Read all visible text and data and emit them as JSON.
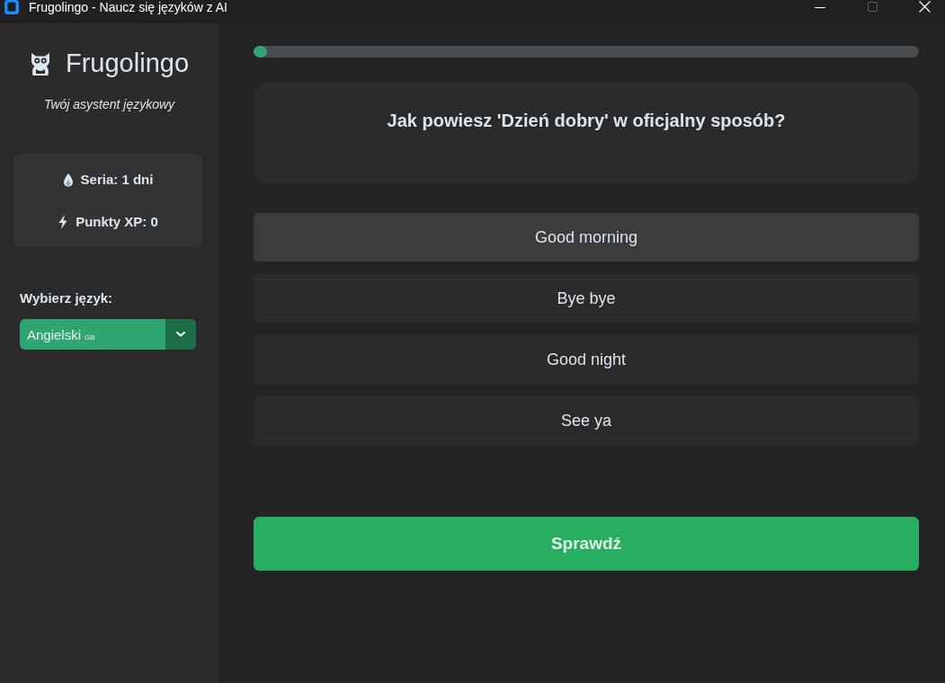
{
  "window": {
    "title": "Frugolingo - Naucz się języków z AI",
    "controls": [
      {
        "kind": "minimize",
        "disabled": false
      },
      {
        "kind": "maximize",
        "disabled": true
      },
      {
        "kind": "close",
        "disabled": false
      }
    ]
  },
  "sidebar": {
    "app_name": "Frugolingo",
    "tagline": "Twój asystent językowy",
    "stats": [
      {
        "kind": "streak",
        "label": "Seria: 1 dni"
      },
      {
        "kind": "xp",
        "label": "Punkty XP: 0"
      }
    ],
    "language": {
      "label": "Wybierz język:",
      "value": "Angielski $_{GB}$"
    }
  },
  "progress": {
    "level": 0.02
  },
  "question": {
    "text": "Jak powiesz 'Dzień dobry' w oficjalny sposób?"
  },
  "options": [
    {
      "label": "Good morning",
      "selected": true
    },
    {
      "label": "Bye bye",
      "selected": false
    },
    {
      "label": "Good night",
      "selected": false
    },
    {
      "label": "See ya",
      "selected": false
    }
  ],
  "check_button": {
    "label": "Sprawdź"
  }
}
